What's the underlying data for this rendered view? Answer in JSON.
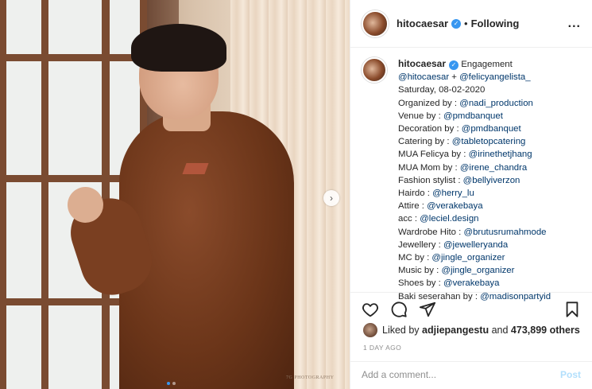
{
  "post": {
    "username": "hitocaesar",
    "follow_separator": "•",
    "follow_status": "Following",
    "more_label": "..."
  },
  "photo": {
    "watermark": "7G PHOTOGRAPHY",
    "next_label": "›",
    "slide_index": 1,
    "slide_count": 2
  },
  "caption": {
    "username": "hitocaesar",
    "first_text": " Engagement",
    "lines": [
      [
        {
          "t": "@hitocaesar",
          "m": true
        },
        {
          "t": " + ",
          "m": false
        },
        {
          "t": "@felicyangelista_",
          "m": true
        }
      ],
      [
        {
          "t": "Saturday, 08-02-2020",
          "m": false
        }
      ],
      [
        {
          "t": "Organized by : ",
          "m": false
        },
        {
          "t": "@nadi_production",
          "m": true
        }
      ],
      [
        {
          "t": "Venue by : ",
          "m": false
        },
        {
          "t": "@pmdbanquet",
          "m": true
        }
      ],
      [
        {
          "t": "Decoration by : ",
          "m": false
        },
        {
          "t": "@pmdbanquet",
          "m": true
        }
      ],
      [
        {
          "t": "Catering by : ",
          "m": false
        },
        {
          "t": "@tabletopcatering",
          "m": true
        }
      ],
      [
        {
          "t": "MUA Felicya by : ",
          "m": false
        },
        {
          "t": "@irinethetjhang",
          "m": true
        }
      ],
      [
        {
          "t": "MUA Mom by : ",
          "m": false
        },
        {
          "t": "@irene_chandra",
          "m": true
        }
      ],
      [
        {
          "t": "Fashion stylist : ",
          "m": false
        },
        {
          "t": "@bellyiverzon",
          "m": true
        }
      ],
      [
        {
          "t": "Hairdo : ",
          "m": false
        },
        {
          "t": "@herry_lu",
          "m": true
        }
      ],
      [
        {
          "t": "Attire : ",
          "m": false
        },
        {
          "t": "@verakebaya",
          "m": true
        }
      ],
      [
        {
          "t": "acc : ",
          "m": false
        },
        {
          "t": "@leciel.design",
          "m": true
        }
      ],
      [
        {
          "t": "Wardrobe Hito : ",
          "m": false
        },
        {
          "t": "@brutusrumahmode",
          "m": true
        }
      ],
      [
        {
          "t": "Jewellery : ",
          "m": false
        },
        {
          "t": "@jewelleryanda",
          "m": true
        }
      ],
      [
        {
          "t": "MC by : ",
          "m": false
        },
        {
          "t": "@jingle_organizer",
          "m": true
        }
      ],
      [
        {
          "t": "Music by : ",
          "m": false
        },
        {
          "t": "@jingle_organizer",
          "m": true
        }
      ],
      [
        {
          "t": "Shoes by : ",
          "m": false
        },
        {
          "t": "@verakebaya",
          "m": true
        }
      ],
      [
        {
          "t": "Baki seserahan by : ",
          "m": false
        },
        {
          "t": "@madisonpartyid",
          "m": true
        }
      ]
    ]
  },
  "actions": {
    "icons": [
      "heart-icon",
      "comment-icon",
      "share-icon",
      "bookmark-icon"
    ]
  },
  "likes": {
    "prefix": "Liked by ",
    "user": "adjiepangestu",
    "middle": " and ",
    "count": "473,899 others"
  },
  "timestamp": "1 DAY AGO",
  "comment": {
    "placeholder": "Add a comment...",
    "post_label": "Post"
  },
  "colors": {
    "verified": "#3897f0",
    "mention": "#00376b",
    "post_disabled": "#b2dffc"
  }
}
